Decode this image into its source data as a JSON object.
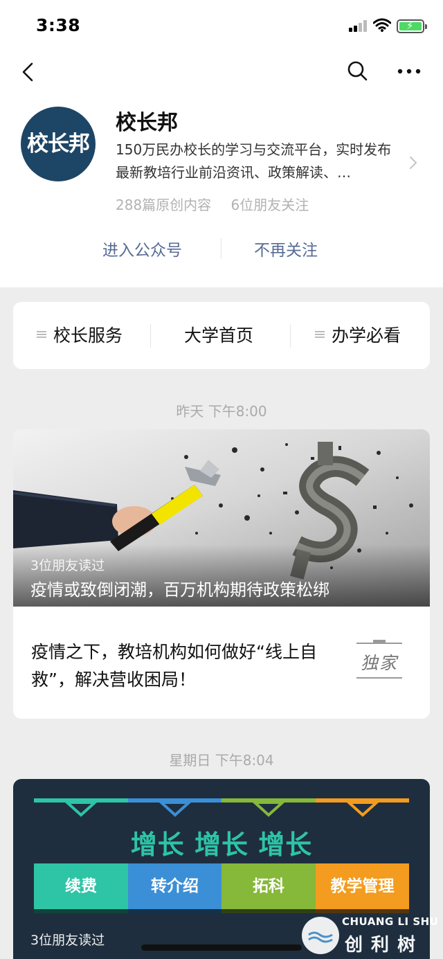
{
  "status_bar": {
    "time": "3:38"
  },
  "nav": {
    "back_icon": "chevron-left-icon",
    "search_icon": "search-icon",
    "more_icon": "more-dots-icon"
  },
  "profile": {
    "avatar_text": "校长邦",
    "name": "校长邦",
    "description": "150万民办校长的学习与交流平台，实时发布最新教培行业前沿资讯、政策解读、…",
    "original_count": "288篇原创内容",
    "friends_following": "6位朋友关注",
    "enter_button": "进入公众号",
    "unfollow_button": "不再关注"
  },
  "menu": {
    "items": [
      {
        "label": "校长服务",
        "has_submenu": true
      },
      {
        "label": "大学首页",
        "has_submenu": false
      },
      {
        "label": "办学必看",
        "has_submenu": true
      }
    ]
  },
  "feed": [
    {
      "timestamp": "昨天 下午8:00",
      "cover_readers": "3位朋友读过",
      "cover_title": "疫情或致倒闭潮，百万机构期待政策松绑",
      "sub_title": "疫情之下，教培机构如何做好“线上自救”，解决营收困局！",
      "sub_thumb_text": "独家"
    },
    {
      "timestamp": "星期日 下午8:04",
      "cover_heading": "增长 增长 增长",
      "cover_tiles": [
        {
          "label": "续费",
          "color": "#2ec4a6"
        },
        {
          "label": "转介绍",
          "color": "#3b8fd6"
        },
        {
          "label": "拓科",
          "color": "#86b83a"
        },
        {
          "label": "教学管理",
          "color": "#f39c1f"
        }
      ],
      "cover_readers": "3位朋友读过"
    }
  ],
  "watermark": {
    "en": "CHUANG LI SHU",
    "cn": "创利树"
  },
  "colors": {
    "link": "#576b95",
    "avatar_bg": "#1d4566",
    "card2_bg": "#1e2e3f"
  }
}
